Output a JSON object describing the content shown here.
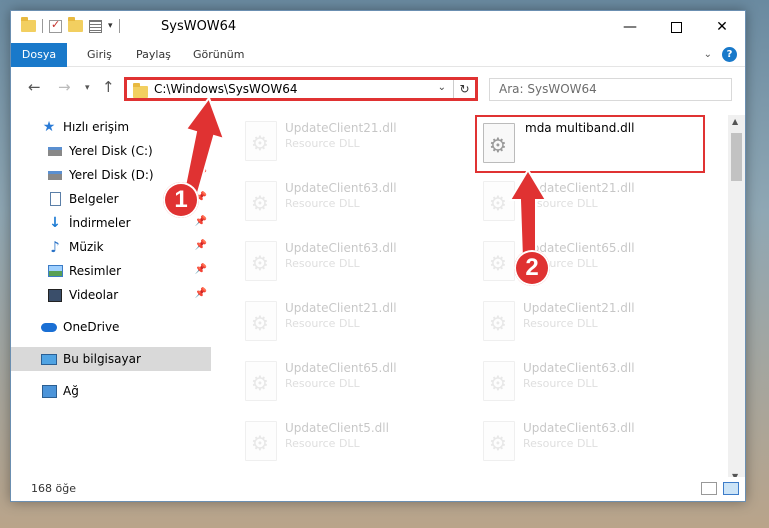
{
  "window": {
    "title": "SysWOW64",
    "min_label": "—",
    "close_label": "✕"
  },
  "ribbon": {
    "tabs": [
      "Dosya",
      "Giriş",
      "Paylaş",
      "Görünüm"
    ],
    "help": "?"
  },
  "navbar": {
    "address": "C:\\Windows\\SysWOW64",
    "search_placeholder": "Ara: SysWOW64"
  },
  "sidebar": {
    "items": [
      {
        "label": "Hızlı erişim",
        "icon": "star-icon"
      },
      {
        "label": "Yerel Disk (C:)",
        "icon": "drive-icon",
        "pinned": true
      },
      {
        "label": "Yerel Disk (D:)",
        "icon": "drive-icon",
        "pinned": true
      },
      {
        "label": "Belgeler",
        "icon": "document-icon",
        "pinned": true
      },
      {
        "label": "İndirmeler",
        "icon": "download-icon",
        "pinned": true
      },
      {
        "label": "Müzik",
        "icon": "music-icon",
        "pinned": true
      },
      {
        "label": "Resimler",
        "icon": "picture-icon",
        "pinned": true
      },
      {
        "label": "Videolar",
        "icon": "video-icon",
        "pinned": true
      },
      {
        "label": "OneDrive",
        "icon": "cloud-icon"
      },
      {
        "label": "Bu bilgisayar",
        "icon": "computer-icon",
        "selected": true
      },
      {
        "label": "Ağ",
        "icon": "network-icon"
      }
    ]
  },
  "files": {
    "left": [
      {
        "name": "UpdateClient21.dll",
        "type": "Resource DLL"
      },
      {
        "name": "UpdateClient63.dll",
        "type": "Resource DLL"
      },
      {
        "name": "UpdateClient63.dll",
        "type": "Resource DLL"
      },
      {
        "name": "UpdateClient21.dll",
        "type": "Resource DLL"
      },
      {
        "name": "UpdateClient65.dll",
        "type": "Resource DLL"
      },
      {
        "name": "UpdateClient5.dll",
        "type": "Resource DLL"
      }
    ],
    "right": [
      {
        "name": "mda multiband.dll",
        "type": ""
      },
      {
        "name": "UpdateClient21.dll",
        "type": "Resource DLL"
      },
      {
        "name": "UpdateClient65.dll",
        "type": "Resource DLL"
      },
      {
        "name": "UpdateClient21.dll",
        "type": "Resource DLL"
      },
      {
        "name": "UpdateClient63.dll",
        "type": "Resource DLL"
      },
      {
        "name": "UpdateClient63.dll",
        "type": "Resource DLL"
      }
    ]
  },
  "status": {
    "count": "168 öğe"
  },
  "annotations": {
    "step1": "1",
    "step2": "2",
    "color": "#e03232"
  },
  "colors": {
    "accent": "#1979ca",
    "highlight": "#e03232"
  }
}
